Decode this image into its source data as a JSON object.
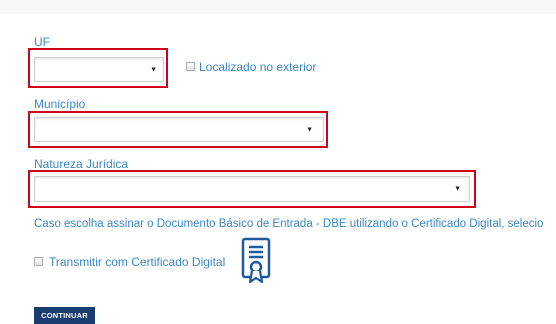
{
  "fields": {
    "uf": {
      "label": "UF",
      "value": ""
    },
    "exterior": {
      "label": "Localizado no exterior",
      "checked": false
    },
    "municipio": {
      "label": "Município",
      "value": ""
    },
    "natureza": {
      "label": "Natureza Jurídica",
      "value": ""
    }
  },
  "info_text": "Caso escolha assinar o Documento Básico de Entrada - DBE utilizando o Certificado Digital, selecio",
  "certificate": {
    "label": "Transmitir com Certificado Digital",
    "checked": false,
    "icon": "certificate-icon"
  },
  "submit_label": "CONTINUAR",
  "colors": {
    "label": "#3b87c4",
    "highlight": "#d0021b",
    "button": "#1a3c6e"
  }
}
